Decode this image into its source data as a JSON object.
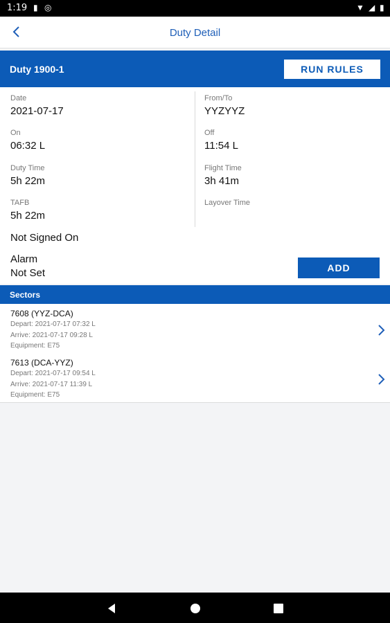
{
  "status_bar": {
    "time": "1:19"
  },
  "header": {
    "title": "Duty Detail"
  },
  "duty": {
    "title": "Duty 1900-1",
    "run_rules_label": "RUN RULES"
  },
  "details": {
    "date": {
      "label": "Date",
      "value": "2021-07-17"
    },
    "from_to": {
      "label": "From/To",
      "value": "YYZYYZ"
    },
    "on": {
      "label": "On",
      "value": "06:32 L"
    },
    "off": {
      "label": "Off",
      "value": "11:54 L"
    },
    "duty_time": {
      "label": "Duty Time",
      "value": "5h 22m"
    },
    "flight_time": {
      "label": "Flight Time",
      "value": "3h 41m"
    },
    "tafb": {
      "label": "TAFB",
      "value": "5h 22m"
    },
    "layover_time": {
      "label": "Layover Time",
      "value": ""
    },
    "signed_on": "Not Signed On",
    "alarm_label": "Alarm",
    "alarm_value": "Not Set",
    "add_label": "ADD"
  },
  "sectors": {
    "title": "Sectors",
    "items": [
      {
        "title": "7608 (YYZ-DCA)",
        "depart": "Depart: 2021-07-17 07:32 L",
        "arrive": "Arrive: 2021-07-17 09:28 L",
        "equipment": "Equipment: E75"
      },
      {
        "title": "7613 (DCA-YYZ)",
        "depart": "Depart: 2021-07-17 09:54 L",
        "arrive": "Arrive: 2021-07-17 11:39 L",
        "equipment": "Equipment: E75"
      }
    ]
  },
  "icons": {
    "back": "back-arrow-icon",
    "chevron": "chevron-right-icon",
    "nav_back": "nav-back-icon",
    "nav_home": "nav-home-icon",
    "nav_recents": "nav-recents-icon"
  },
  "colors": {
    "primary": "#0c5bb7",
    "title": "#1f5fb8",
    "background": "#f3f4f6"
  }
}
